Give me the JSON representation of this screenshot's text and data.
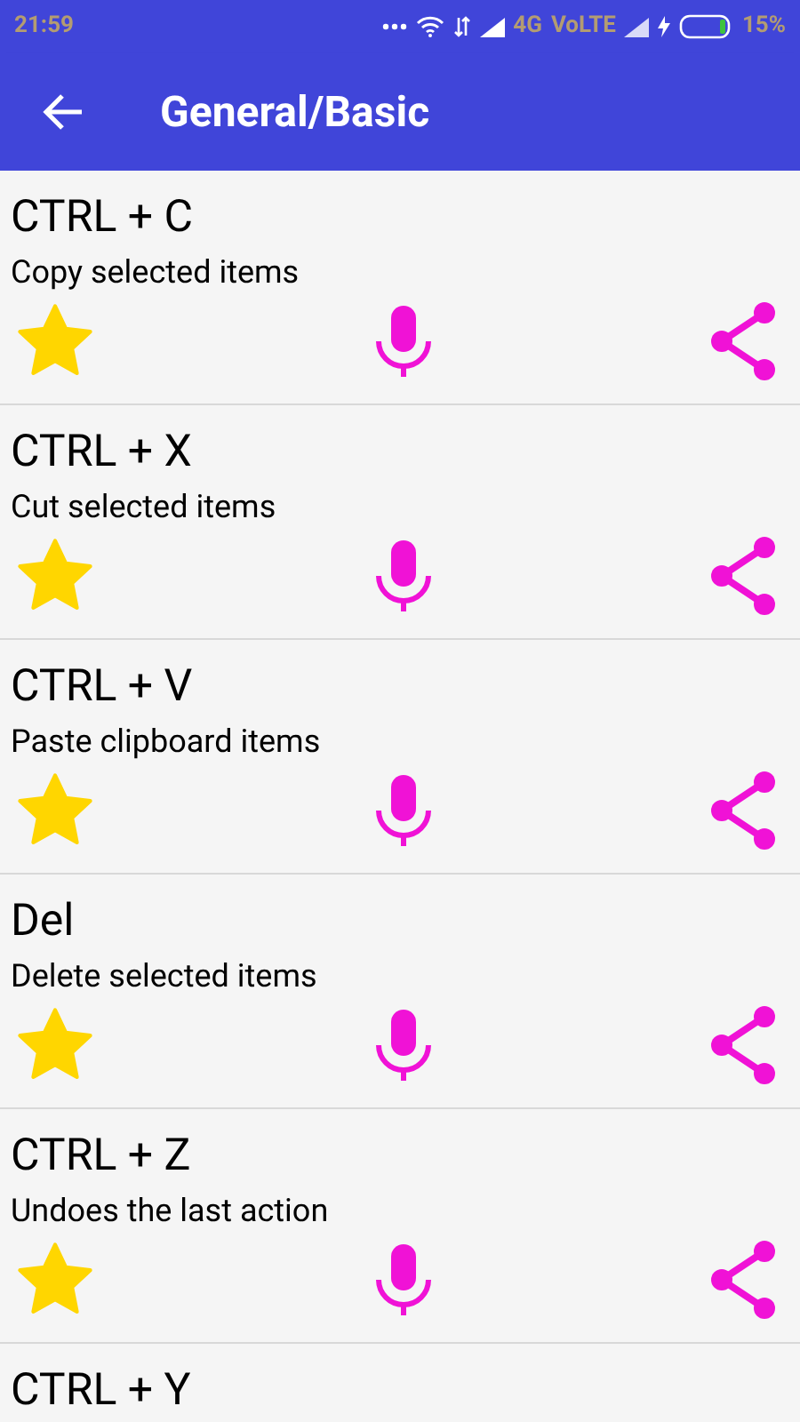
{
  "status_bar": {
    "time": "21:59",
    "network": "4G",
    "volte": "VoLTE",
    "battery": "15%"
  },
  "app_bar": {
    "title": "General/Basic"
  },
  "shortcuts": [
    {
      "keys": "CTRL + C",
      "description": "Copy selected items",
      "favorite": true
    },
    {
      "keys": "CTRL + X",
      "description": "Cut selected items",
      "favorite": true
    },
    {
      "keys": "CTRL + V",
      "description": "Paste clipboard items",
      "favorite": true
    },
    {
      "keys": "Del",
      "description": "Delete selected items",
      "favorite": true
    },
    {
      "keys": "CTRL + Z",
      "description": "Undoes the last action",
      "favorite": true
    },
    {
      "keys": "CTRL + Y"
    }
  ]
}
